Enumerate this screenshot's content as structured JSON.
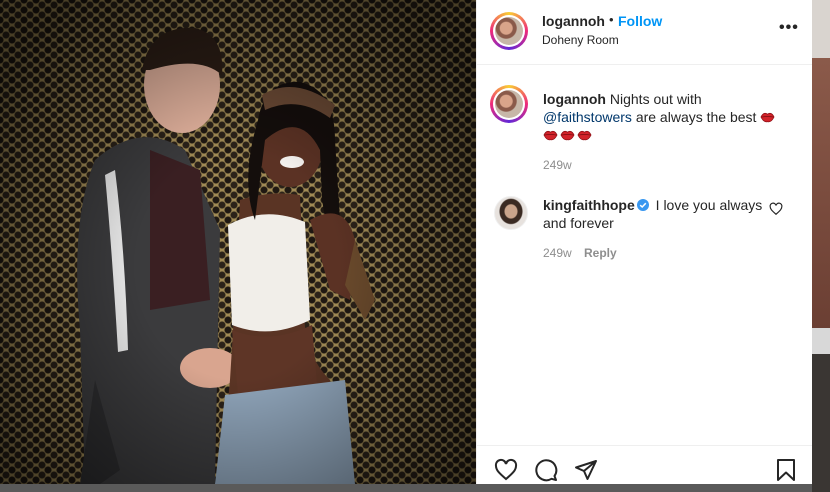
{
  "post": {
    "username": "logannoh",
    "follow_label": "Follow",
    "location": "Doheny Room",
    "more_label": "•••"
  },
  "caption": {
    "username": "logannoh",
    "text_before": "Nights out with",
    "mention": "@faithstowers",
    "text_after": "are always the best",
    "time": "249w"
  },
  "comment": {
    "username": "kingfaithhope",
    "text": "I love you always and forever",
    "time": "249w",
    "reply_label": "Reply"
  },
  "icons": {
    "more": "more-options-icon",
    "verified": "verified-badge-icon",
    "like_comment": "heart-outline-icon",
    "like": "heart-outline-icon",
    "comment": "comment-bubble-icon",
    "share": "paper-plane-icon",
    "save": "bookmark-icon",
    "lips": "kiss-mark-emoji"
  },
  "colors": {
    "link": "#0095f6",
    "mention": "#00376b",
    "verified": "#3897f0",
    "muted": "#8e8e8e"
  }
}
